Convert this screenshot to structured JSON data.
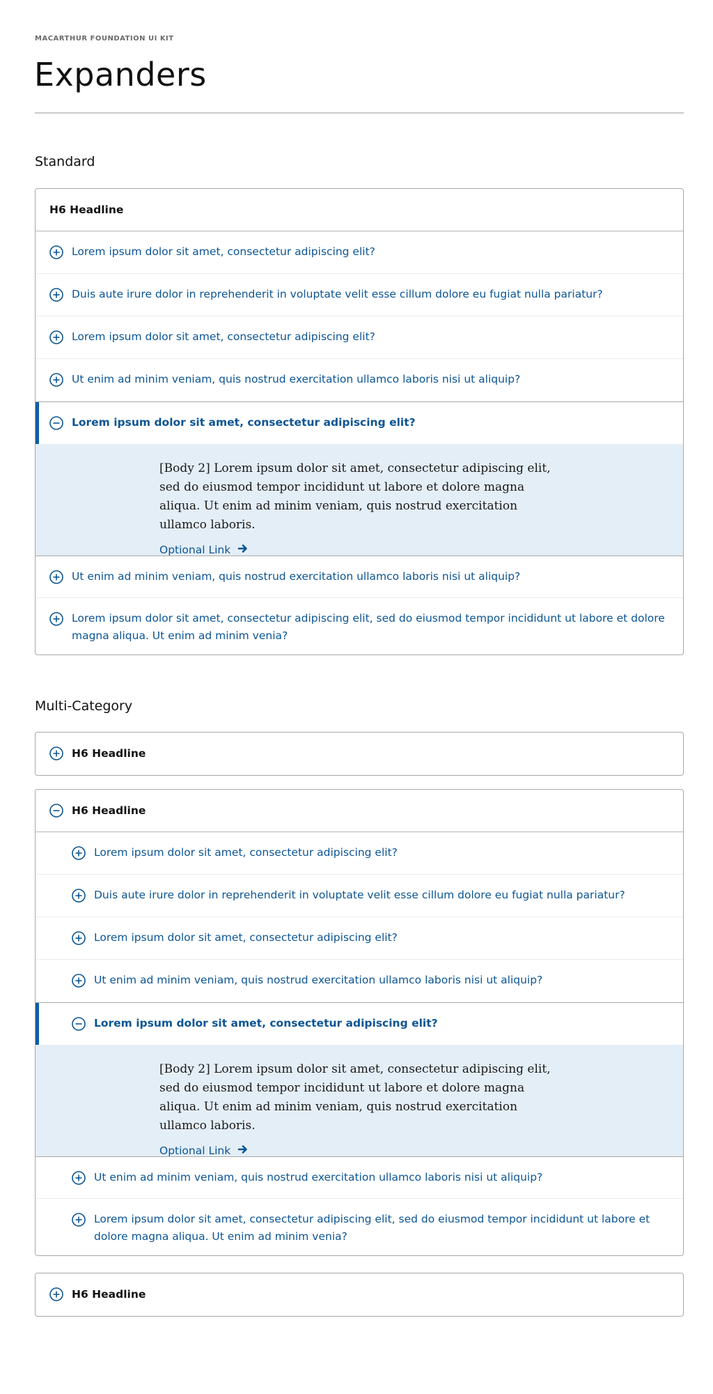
{
  "header": {
    "kit_label": "MACARTHUR FOUNDATION UI KIT",
    "title": "Expanders"
  },
  "colors": {
    "link": "#0c5594",
    "accent_bar": "#0f5da3",
    "body_bg": "#e4eef7",
    "border": "#a8a8a8"
  },
  "icons": {
    "collapsed": "plus-circle-icon",
    "expanded": "minus-circle-icon",
    "link_arrow": "arrow-right-icon"
  },
  "standard": {
    "section_title": "Standard",
    "headline": "H6 Headline",
    "items": [
      {
        "label": "Lorem ipsum dolor sit amet, consectetur adipiscing elit?",
        "expanded": false
      },
      {
        "label": "Duis aute irure dolor in reprehenderit in voluptate velit esse cillum dolore eu fugiat nulla pariatur?",
        "expanded": false
      },
      {
        "label": "Lorem ipsum dolor sit amet, consectetur adipiscing elit?",
        "expanded": false
      },
      {
        "label": "Ut enim ad minim veniam, quis nostrud exercitation ullamco laboris nisi ut aliquip?",
        "expanded": false
      },
      {
        "label": "Lorem ipsum dolor sit amet, consectetur adipiscing elit?",
        "expanded": true
      },
      {
        "label": "Ut enim ad minim veniam, quis nostrud exercitation ullamco laboris nisi ut aliquip?",
        "expanded": false
      },
      {
        "label": "Lorem ipsum dolor sit amet, consectetur adipiscing elit, sed do eiusmod tempor incididunt ut labore et dolore magna aliqua. Ut enim ad minim venia?",
        "expanded": false
      }
    ],
    "body": "[Body 2] Lorem ipsum dolor sit amet, consectetur adipiscing elit, sed do eiusmod tempor incididunt ut labore et dolore magna aliqua. Ut enim ad minim veniam, quis nostrud exercitation ullamco laboris.",
    "link_label": "Optional Link"
  },
  "multi": {
    "section_title": "Multi-Category",
    "categories": [
      {
        "headline": "H6 Headline",
        "expanded": false
      },
      {
        "headline": "H6 Headline",
        "expanded": true
      },
      {
        "headline": "H6 Headline",
        "expanded": false
      }
    ],
    "items": [
      {
        "label": "Lorem ipsum dolor sit amet, consectetur adipiscing elit?",
        "expanded": false
      },
      {
        "label": "Duis aute irure dolor in reprehenderit in voluptate velit esse cillum dolore eu fugiat nulla pariatur?",
        "expanded": false
      },
      {
        "label": "Lorem ipsum dolor sit amet, consectetur adipiscing elit?",
        "expanded": false
      },
      {
        "label": "Ut enim ad minim veniam, quis nostrud exercitation ullamco laboris nisi ut aliquip?",
        "expanded": false
      },
      {
        "label": "Lorem ipsum dolor sit amet, consectetur adipiscing elit?",
        "expanded": true
      },
      {
        "label": "Ut enim ad minim veniam, quis nostrud exercitation ullamco laboris nisi ut aliquip?",
        "expanded": false
      },
      {
        "label": "Lorem ipsum dolor sit amet, consectetur adipiscing elit, sed do eiusmod tempor incididunt ut labore et dolore magna aliqua. Ut enim ad minim venia?",
        "expanded": false
      }
    ],
    "body": "[Body 2] Lorem ipsum dolor sit amet, consectetur adipiscing elit, sed do eiusmod tempor incididunt ut labore et dolore magna aliqua. Ut enim ad minim veniam, quis nostrud exercitation ullamco laboris.",
    "link_label": "Optional Link"
  }
}
